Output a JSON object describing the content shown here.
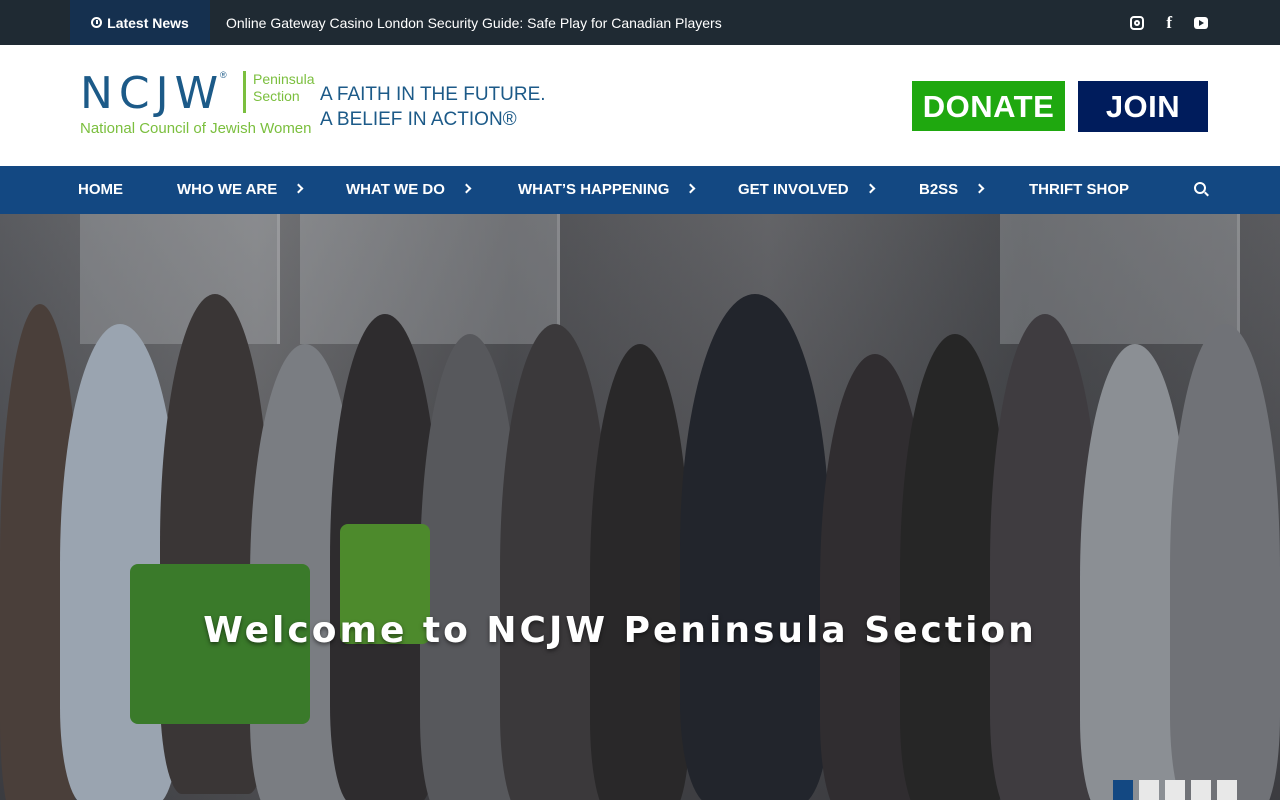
{
  "topbar": {
    "latest_label": "Latest News",
    "headline": "Online Gateway Casino London Security Guide: Safe Play for Canadian Players",
    "social": [
      "instagram-icon",
      "facebook-icon",
      "youtube-icon"
    ]
  },
  "header": {
    "logo": {
      "letters": "NCJW",
      "section": "Peninsula\nSection",
      "council": "National Council of Jewish Women",
      "tagline_1": "A FAITH IN THE FUTURE.",
      "tagline_2": "A BELIEF IN ACTION®"
    },
    "donate_label": "DONATE",
    "join_label": "JOIN"
  },
  "nav": {
    "items": [
      {
        "label": "HOME"
      },
      {
        "label": "WHO WE ARE"
      },
      {
        "label": "WHAT WE DO"
      },
      {
        "label": "WHAT’S HAPPENING"
      },
      {
        "label": "GET INVOLVED"
      },
      {
        "label": "B2SS"
      },
      {
        "label": "THRIFT SHOP"
      }
    ]
  },
  "hero": {
    "title": "Welcome to NCJW Peninsula Section",
    "slides": 5,
    "active_slide": 1
  },
  "colors": {
    "topbar": "#1f2a33",
    "nav": "#134882",
    "donate": "#1fa80f",
    "join": "#001c5c",
    "brand_blue": "#1c5a88",
    "brand_green": "#7bbf3e"
  }
}
